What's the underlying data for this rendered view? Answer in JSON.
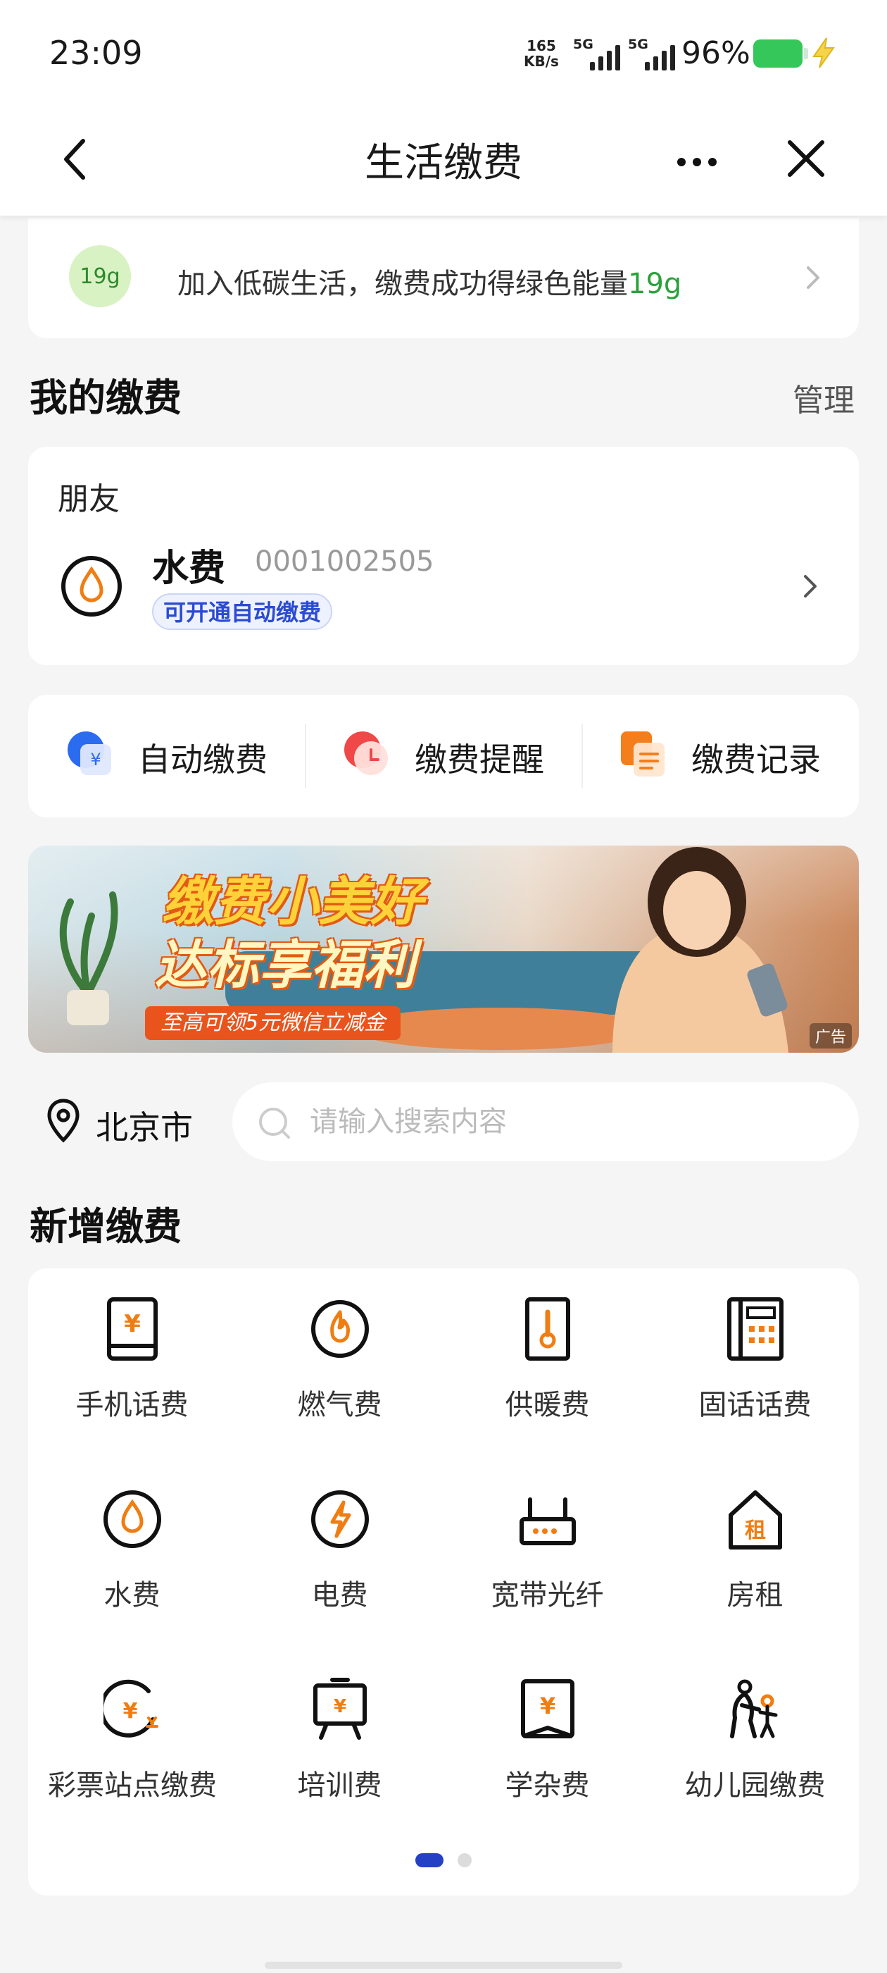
{
  "status_bar": {
    "time": "23:09",
    "net_speed": "165",
    "net_unit": "KB/s",
    "sig1": "5G",
    "sig2": "5G",
    "battery": "96%"
  },
  "nav": {
    "title": "生活缴费"
  },
  "eco": {
    "badge": "19g",
    "text": "加入低碳生活，缴费成功得绿色能量",
    "value": "19g"
  },
  "my_bills": {
    "title": "我的缴费",
    "manage": "管理",
    "group": "朋友",
    "item": {
      "name": "水费",
      "account": "0001002505",
      "tag": "可开通自动缴费"
    }
  },
  "tools": [
    {
      "label": "自动缴费",
      "icon": "auto-pay-icon"
    },
    {
      "label": "缴费提醒",
      "icon": "reminder-clock-icon"
    },
    {
      "label": "缴费记录",
      "icon": "record-doc-icon"
    }
  ],
  "banner": {
    "line1": "缴费小美好",
    "line2": "达标享福利",
    "promo": "至高可领5元微信立减金",
    "ad": "广告"
  },
  "location": {
    "city": "北京市"
  },
  "search": {
    "placeholder": "请输入搜索内容"
  },
  "new_bills": {
    "title": "新增缴费",
    "items": [
      {
        "label": "手机话费",
        "icon": "phone-bill-icon"
      },
      {
        "label": "燃气费",
        "icon": "gas-flame-icon"
      },
      {
        "label": "供暖费",
        "icon": "heating-thermometer-icon"
      },
      {
        "label": "固话话费",
        "icon": "landline-phone-icon"
      },
      {
        "label": "水费",
        "icon": "water-drop-icon"
      },
      {
        "label": "电费",
        "icon": "electric-bolt-icon"
      },
      {
        "label": "宽带光纤",
        "icon": "broadband-router-icon"
      },
      {
        "label": "房租",
        "icon": "rent-house-icon"
      },
      {
        "label": "彩票站点缴费",
        "icon": "lottery-icon"
      },
      {
        "label": "培训费",
        "icon": "training-board-icon"
      },
      {
        "label": "学杂费",
        "icon": "tuition-book-icon"
      },
      {
        "label": "幼儿园缴费",
        "icon": "kindergarten-icon"
      }
    ]
  },
  "colors": {
    "accent_orange": "#f07d12",
    "eco_green": "#2aa23a",
    "brand_blue": "#2441c6"
  }
}
